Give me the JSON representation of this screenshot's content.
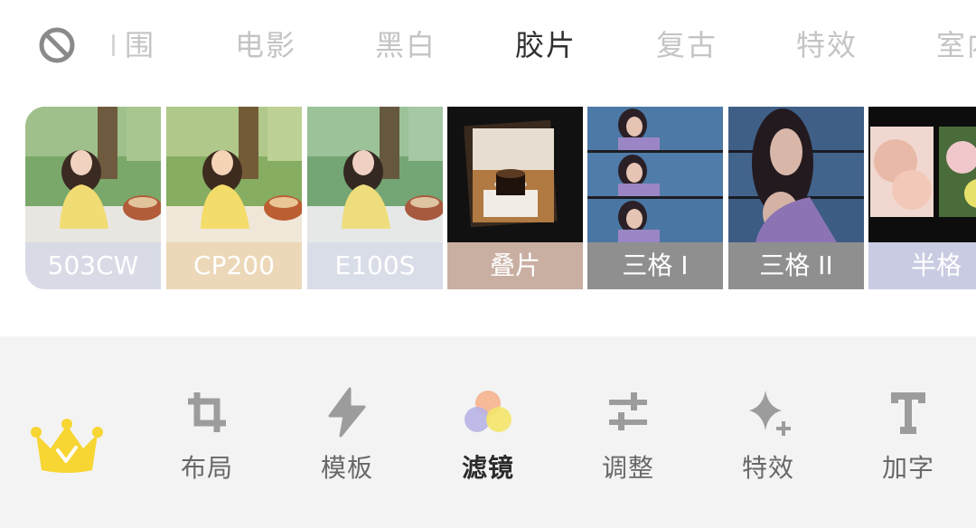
{
  "category_tabs": {
    "partial_first": "围",
    "items": [
      "电影",
      "黑白",
      "胶片",
      "复古",
      "特效",
      "室内"
    ],
    "active": "胶片"
  },
  "filters": [
    {
      "label": "503CW",
      "label_bg": "#d8dbe6",
      "scene": "girl-picnic"
    },
    {
      "label": "CP200",
      "label_bg": "#ecd8b8",
      "scene": "girl-picnic"
    },
    {
      "label": "E100S",
      "label_bg": "#d9dde8",
      "scene": "girl-picnic"
    },
    {
      "label": "叠片",
      "label_bg": "#c9afa2",
      "scene": "coffee-stack"
    },
    {
      "label": "三格 I",
      "label_bg": "#8f8f8f",
      "scene": "sea-portrait-triple"
    },
    {
      "label": "三格 II",
      "label_bg": "#8f8f8f",
      "scene": "sea-portrait-split"
    },
    {
      "label": "半格",
      "label_bg": "#c8cbe2",
      "scene": "peony-half-frame"
    }
  ],
  "toolbar": {
    "items": [
      {
        "label": "布局",
        "icon": "crop-icon"
      },
      {
        "label": "模板",
        "icon": "lightning-icon"
      },
      {
        "label": "滤镜",
        "icon": "color-circles-icon",
        "active": true
      },
      {
        "label": "调整",
        "icon": "sliders-icon"
      },
      {
        "label": "特效",
        "icon": "sparkle-icon"
      },
      {
        "label": "加字",
        "icon": "text-icon"
      }
    ]
  },
  "colors": {
    "active_tab": "#303030",
    "inactive_tab": "#c4c4c4",
    "toolbar_bg": "#f3f3f3",
    "crown": "#f7d533"
  }
}
